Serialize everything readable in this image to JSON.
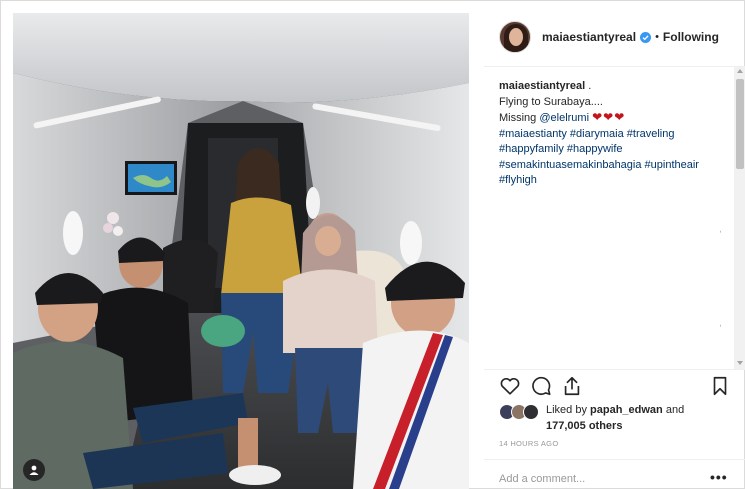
{
  "post": {
    "author": {
      "username": "maiaestiantyreal",
      "verified": true,
      "follow_state": "Following",
      "separator": "•"
    },
    "caption": {
      "username": "maiaestiantyreal",
      "suffix": " .",
      "line1": "Flying to Surabaya....",
      "line2_prefix": "Missing ",
      "mention": "@elelrumi",
      "hearts": "❤❤❤",
      "hashtags": "#maiaestianty #diarymaia #traveling #happyfamily #happywife #semakintuasemakinbahagia #upintheair #flyhigh"
    },
    "likes": {
      "prefix": "Liked by ",
      "first_user": "papah_edwan",
      "and": " and",
      "others": "177,005 others"
    },
    "timestamp": "14 HOURS AGO",
    "comment_placeholder": "Add a comment...",
    "more_label": "•••"
  },
  "icons": {
    "like": "heart-outline-icon",
    "comment": "speech-bubble-icon",
    "share": "share-upload-icon",
    "save": "bookmark-icon",
    "verified": "verified-badge-icon",
    "tag": "person-tag-icon"
  },
  "colors": {
    "link": "#003569",
    "verified_blue": "#3897f0",
    "heart_red": "#c4151c",
    "muted": "#999999",
    "border": "#dbdbdb"
  }
}
